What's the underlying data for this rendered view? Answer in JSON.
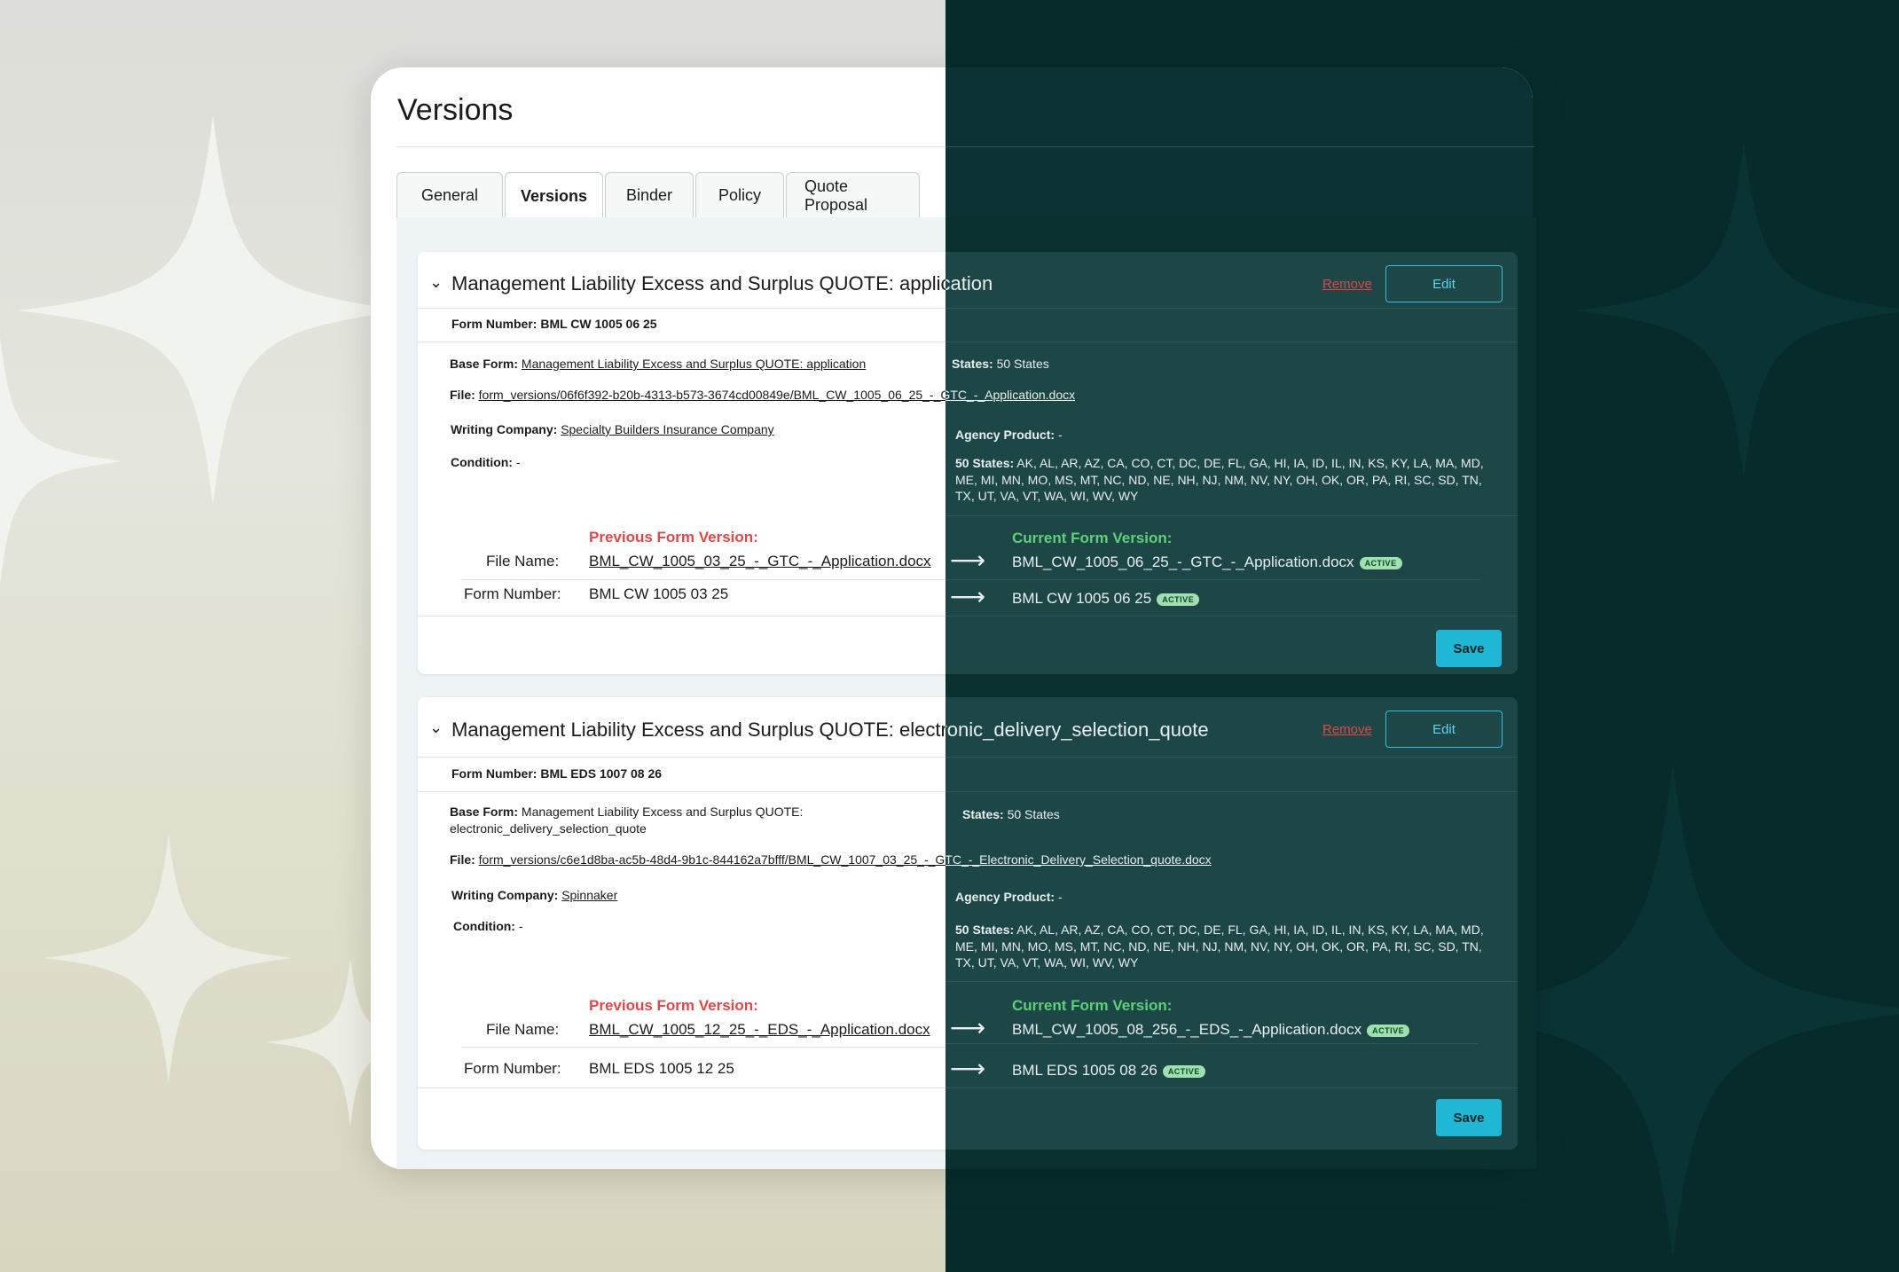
{
  "page": {
    "title": "Versions"
  },
  "tabs": [
    {
      "label": "General"
    },
    {
      "label": "Versions"
    },
    {
      "label": "Binder"
    },
    {
      "label": "Policy"
    },
    {
      "label": "Quote Proposal"
    }
  ],
  "labels": {
    "form_number": "Form Number:",
    "base_form": "Base Form:",
    "file": "File:",
    "writing_company": "Writing Company:",
    "condition": "Condition:",
    "states": "States:",
    "agency_product": "Agency Product:",
    "fifty_states": "50 States:",
    "previous_version": "Previous Form Version:",
    "current_version": "Current Form Version:",
    "file_name": "File Name:",
    "form_number_row": "Form Number:",
    "remove": "Remove",
    "edit": "Edit",
    "save": "Save",
    "active": "ACTIVE"
  },
  "sections": [
    {
      "title": "Management Liability Excess and Surplus QUOTE: application",
      "form_number": "BML CW 1005 06 25",
      "base_form": "Management Liability Excess and Surplus QUOTE: application",
      "file": "form_versions/06f6f392-b20b-4313-b573-3674cd00849e/BML_CW_1005_06_25_-_GTC_-_Application.docx",
      "writing_company": "Specialty Builders Insurance Company",
      "condition": "-",
      "states": "50 States",
      "agency_product": "-",
      "state_list": "AK, AL, AR, AZ, CA, CO, CT, DC, DE, FL, GA, HI, IA, ID, IL, IN, KS, KY, LA, MA, MD, ME, MI, MN, MO, MS, MT, NC, ND, NE, NH, NJ, NM, NV, NY, OH, OK, OR, PA, RI, SC, SD, TN, TX, UT, VA, VT, WA, WI, WV, WY",
      "prev_file_name": "BML_CW_1005_03_25_-_GTC_-_Application.docx",
      "prev_form_number": "BML CW 1005 03 25",
      "curr_file_name": "BML_CW_1005_06_25_-_GTC_-_Application.docx",
      "curr_form_number": "BML CW 1005 06 25"
    },
    {
      "title": "Management Liability Excess and Surplus QUOTE: electronic_delivery_selection_quote",
      "form_number": "BML EDS 1007 08 26",
      "base_form": "Management Liability Excess and Surplus QUOTE: electronic_delivery_selection_quote",
      "file": "form_versions/c6e1d8ba-ac5b-48d4-9b1c-844162a7bfff/BML_CW_1007_03_25_-_GTC_-_Electronic_Delivery_Selection_quote.docx",
      "writing_company": "Spinnaker",
      "condition": "-",
      "states": "50 States",
      "agency_product": "-",
      "state_list": "AK, AL, AR, AZ, CA, CO, CT, DC, DE, FL, GA, HI, IA, ID, IL, IN, KS, KY, LA, MA, MD, ME, MI, MN, MO, MS, MT, NC, ND, NE, NH, NJ, NM, NV, NY, OH, OK, OR, PA, RI, SC, SD, TN, TX, UT, VA, VT, WA, WI, WV, WY",
      "prev_file_name": "BML_CW_1005_12_25_-_EDS_-_Application.docx",
      "prev_form_number": "BML EDS 1005 12 25",
      "curr_file_name": "BML_CW_1005_08_256_-_EDS_-_Application.docx",
      "curr_form_number": "BML EDS 1005 08 26"
    }
  ],
  "icons": {
    "chevron": "chevron-down-icon",
    "arrow": "arrow-right-icon",
    "sparkle": "sparkle-icon"
  },
  "colors": {
    "accent": "#1fb7d4",
    "danger": "#e04848",
    "success": "#5ed07a",
    "dark_bg": "#072b2b"
  }
}
